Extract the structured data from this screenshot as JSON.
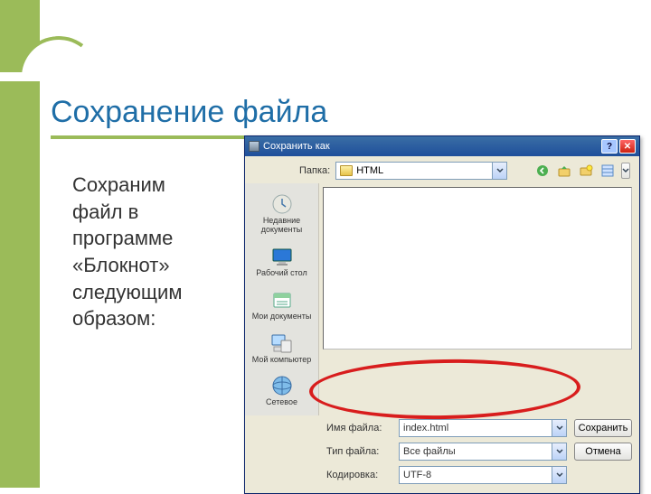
{
  "slide": {
    "title": "Сохранение файла",
    "body": "Сохраним файл в программе «Блокнот» следующим образом:"
  },
  "dialog": {
    "title": "Сохранить как",
    "folder_label": "Папка:",
    "folder_value": "HTML",
    "toolbar_icons": [
      "back-icon",
      "up-icon",
      "new-folder-icon",
      "views-icon"
    ],
    "places": [
      {
        "icon": "recent",
        "label": "Недавние документы"
      },
      {
        "icon": "desktop",
        "label": "Рабочий стол"
      },
      {
        "icon": "mydocs",
        "label": "Мои документы"
      },
      {
        "icon": "computer",
        "label": "Мой компьютер"
      },
      {
        "icon": "network",
        "label": "Сетевое"
      }
    ],
    "filename_label": "Имя файла:",
    "filename_value": "index.html",
    "filetype_label": "Тип файла:",
    "filetype_value": "Все файлы",
    "encoding_label": "Кодировка:",
    "encoding_value": "UTF-8",
    "save_btn": "Сохранить",
    "cancel_btn": "Отмена"
  }
}
